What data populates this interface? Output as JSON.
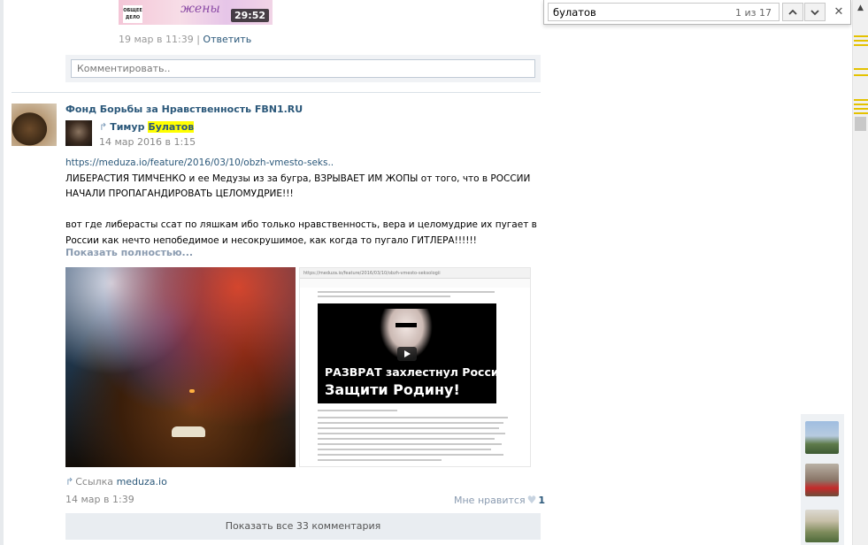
{
  "prev_post": {
    "thumb_logo": "ОБЩЕЕ ДЕЛО",
    "thumb_script": "жены",
    "video_duration": "29:52",
    "date": "19 мар в 11:39",
    "separator": "|",
    "reply": "Ответить",
    "comment_placeholder": "Комментировать.."
  },
  "post": {
    "author": "Фонд Борьбы за Нравственность FBN1.RU",
    "repost": {
      "arrow": "↱",
      "first_name": "Тимур",
      "last_name": "Булатов",
      "date": "14 мар 2016 в 1:15"
    },
    "url": "https://meduza.io/feature/2016/03/10/obzh-vmesto-seks..",
    "text_line1": "ЛИБЕРАСТИЯ ТИМЧЕНКО и ее Медузы из за бугра, ВЗРЫВАЕТ ИМ ЖОПЫ от того, что в РОССИИ НАЧАЛИ ПРОПАГАНДИРОВАТЬ ЦЕЛОМУДРИЕ!!!",
    "text_line2": "вот где либерасты ссат по ляшкам ибо только нравственность, вера и целомудрие их пугает в России как нечто непобедимое и несокрушимое, как когда то пугало ГИТЛЕРА!!!!!!",
    "show_full": "Показать полностью...",
    "screenshot": {
      "address": "https://meduza.io/feature/2016/03/10/obzh-vmesto-seksologii",
      "video_line1": "РАЗВРАТ захлестнул Россию!",
      "video_line2": "Защити Родину!"
    },
    "link_label": "Ссылка",
    "link_domain": "meduza.io",
    "date": "14 мар в 1:39",
    "like_label": "Мне нравится",
    "like_count": "1",
    "show_all_comments": "Показать все 33 комментария"
  },
  "find_bar": {
    "query": "булатов",
    "match_count": "1 из 17",
    "prev_icon": "chevron-up-icon",
    "next_icon": "chevron-down-icon",
    "close_icon": "close-icon"
  },
  "colors": {
    "link": "#2b587a",
    "highlight": "#ffff00",
    "scroll_marks": "#e4c200",
    "button_bg": "#e9edf1"
  }
}
